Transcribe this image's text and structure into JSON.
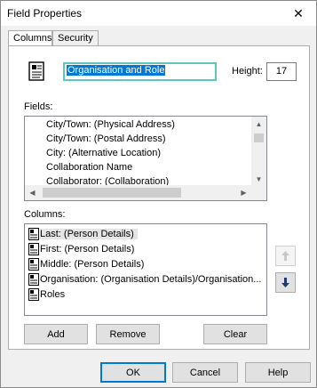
{
  "window": {
    "title": "Field Properties",
    "close_glyph": "✕"
  },
  "tabs": [
    {
      "label": "Columns",
      "active": true
    },
    {
      "label": "Security",
      "active": false
    }
  ],
  "name_field": {
    "value": "Organisation and Role"
  },
  "height": {
    "label": "Height:",
    "value": "17"
  },
  "fields": {
    "label": "Fields:",
    "items": [
      "City/Town: (Physical Address)",
      "City/Town: (Postal Address)",
      "City: (Alternative Location)",
      "Collaboration Name",
      "Collaborator: (Collaboration)"
    ]
  },
  "columns": {
    "label": "Columns:",
    "items": [
      {
        "label": "Last: (Person Details)",
        "selected": true
      },
      {
        "label": "First: (Person Details)",
        "selected": false
      },
      {
        "label": "Middle: (Person Details)",
        "selected": false
      },
      {
        "label": "Organisation: (Organisation Details)/Organisation...",
        "selected": false
      },
      {
        "label": "Roles",
        "selected": false
      }
    ]
  },
  "buttons": {
    "add": "Add",
    "remove": "Remove",
    "clear": "Clear",
    "ok": "OK",
    "cancel": "Cancel",
    "help": "Help"
  },
  "icons": {
    "move_up": "up-arrow-icon",
    "move_down": "down-arrow-icon",
    "document": "document-icon"
  },
  "colors": {
    "accent": "#0078d7",
    "focus_border": "#5ec6bd"
  }
}
